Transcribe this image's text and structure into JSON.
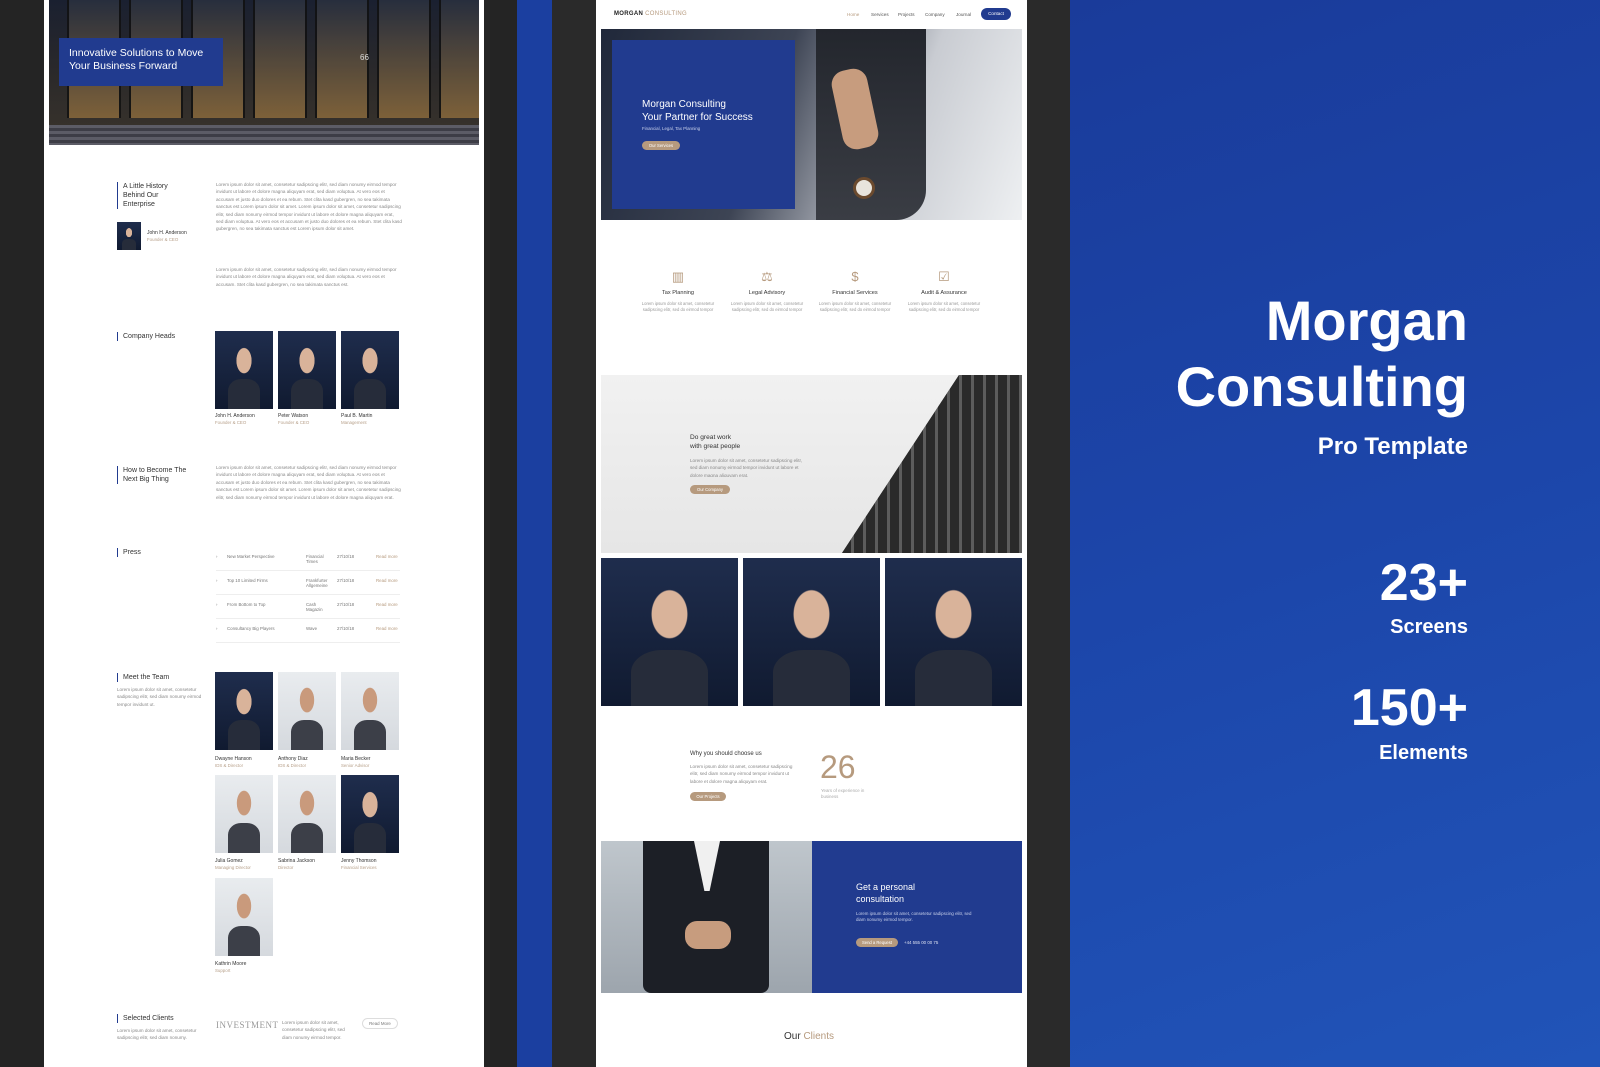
{
  "left_page": {
    "hero_title": "Innovative Solutions to Move Your Business Forward",
    "hero_number": "66",
    "history": {
      "label": "A Little History Behind Our Enterprise",
      "person_name": "John H. Anderson",
      "person_role": "Founder & CEO",
      "paragraph1": "Lorem ipsum dolor sit amet, consetetur sadipscing elitr, sed diam nonumy eirmod tempor invidunt ut labore et dolore magna aliquyam erat, sed diam voluptua. At vero eos et accusam et justo duo dolores et ea rebum. Stet clita kasd gubergren, no sea takimata sanctus est Lorem ipsum dolor sit amet. Lorem ipsum dolor sit amet, consetetur sadipscing elitr, sed diam nonumy eirmod tempor invidunt ut labore et dolore magna aliquyam erat, sed diam voluptua. At vero eos et accusam et justo duo dolores et ea rebum. Stet clita kasd gubergren, no sea takimata sanctus est Lorem ipsum dolor sit amet.",
      "paragraph2": "Lorem ipsum dolor sit amet, consetetur sadipscing elitr, sed diam nonumy eirmod tempor invidunt ut labore et dolore magna aliquyam erat, sed diam voluptua. At vero eos et accusam. Stet clita kasd gubergren, no sea takimata sanctus est."
    },
    "heads": {
      "label": "Company Heads",
      "people": [
        {
          "name": "John H. Anderson",
          "role": "Founder & CEO"
        },
        {
          "name": "Peter Watson",
          "role": "Founder & CEO"
        },
        {
          "name": "Paul B. Martin",
          "role": "Management"
        }
      ]
    },
    "next": {
      "label": "How to Become The Next Big Thing",
      "paragraph": "Lorem ipsum dolor sit amet, consetetur sadipscing elitr, sed diam nonumy eirmod tempor invidunt ut labore et dolore magna aliquyam erat, sed diam voluptua. At vero eos et accusam et justo duo dolores et ea rebum. Stet clita kasd gubergren, no sea takimata sanctus est Lorem ipsum dolor sit amet. Lorem ipsum dolor sit amet, consetetur sadipscing elitr, sed diam nonumy eirmod tempor invidunt ut labore et dolore magna aliquyam erat."
    },
    "press": {
      "label": "Press",
      "read_more": "Read more",
      "rows": [
        {
          "title": "New Market Perspective",
          "source": "Financial Times",
          "date": "27/10/18"
        },
        {
          "title": "Top 10 Limited Firms",
          "source": "Frankfurter Allgemeine",
          "date": "27/10/18"
        },
        {
          "title": "From Bottom to Top",
          "source": "Cash Magazin",
          "date": "27/10/18"
        },
        {
          "title": "Consultancy Big Players",
          "source": "Wave",
          "date": "27/10/18"
        }
      ]
    },
    "team": {
      "label": "Meet the Team",
      "intro": "Lorem ipsum dolor sit amet, consetetur sadipscing elitr, sed diam nonumy eirmod tempor invidunt ut.",
      "members": [
        {
          "name": "Dwayne Hanson",
          "role": "IDS & Director"
        },
        {
          "name": "Anthony Diaz",
          "role": "IDS & Director"
        },
        {
          "name": "Maria Becker",
          "role": "Senior Advisor"
        },
        {
          "name": "Julia Gomez",
          "role": "Managing Director"
        },
        {
          "name": "Sabrina Jackson",
          "role": "Director"
        },
        {
          "name": "Jenny Thomson",
          "role": "Financial Services"
        },
        {
          "name": "Kathrin Moore",
          "role": "Support"
        }
      ]
    },
    "clients": {
      "label": "Selected Clients",
      "intro": "Lorem ipsum dolor sit amet, consetetur sadipscing elitr, sed diam nonumy.",
      "logo": "INVESTMENT",
      "desc": "Lorem ipsum dolor sit amet, consetetur sadipscing elitr, sed diam nonumy eirmod tempor.",
      "button": "Read More"
    }
  },
  "middle_page": {
    "logo_bold": "MORGAN",
    "logo_light": "CONSULTING",
    "nav": [
      "Home",
      "Services",
      "Projects",
      "Company",
      "Journal"
    ],
    "nav_button": "Contact",
    "hero": {
      "title_line1": "Morgan Consulting",
      "title_line2": "Your Partner for Success",
      "subtitle": "Financial, Legal, Tax Planning",
      "button": "Our Services"
    },
    "services": [
      {
        "icon": "chart-icon",
        "title": "Tax Planning",
        "desc": "Lorem ipsum dolor sit amet, consetetur sadipscing elitr, sed do eirmod tempor"
      },
      {
        "icon": "scale-icon",
        "title": "Legal Advisory",
        "desc": "Lorem ipsum dolor sit amet, consetetur sadipscing elitr, sed do eirmod tempor"
      },
      {
        "icon": "dollar-icon",
        "title": "Financial Services",
        "desc": "Lorem ipsum dolor sit amet, consetetur sadipscing elitr, sed do eirmod tempor"
      },
      {
        "icon": "clipboard-icon",
        "title": "Audit & Assurance",
        "desc": "Lorem ipsum dolor sit amet, consetetur sadipscing elitr, sed do eirmod tempor"
      }
    ],
    "work": {
      "title_line1": "Do great work",
      "title_line2": "with great people",
      "desc": "Lorem ipsum dolor sit amet, consetetur sadipscing elitr, sed diam nonumy eirmod tempor invidunt ut labore et dolore magna aliquyam erat.",
      "button": "Our Company"
    },
    "why": {
      "title": "Why you should choose us",
      "desc": "Lorem ipsum dolor sit amet, consetetur sadipscing elitr, sed diam nonumy eirmod tempor invidunt ut labore et dolore magna aliquyam erat.",
      "button": "Our Projects",
      "number": "26",
      "number_caption": "Years of experience in business"
    },
    "consult": {
      "title_line1": "Get a personal",
      "title_line2": "consultation",
      "desc": "Lorem ipsum dolor sit amet, consetetur sadipscing elitr, sed diam nonumy eirmod tempor.",
      "button": "Send a Request",
      "phone": "+44 555 00 00 75"
    },
    "clients_heading_a": "Our",
    "clients_heading_b": "Clients"
  },
  "promo": {
    "title_line1": "Morgan",
    "title_line2": "Consulting",
    "subtitle": "Pro Template",
    "stat1_value": "23+",
    "stat1_label": "Screens",
    "stat2_value": "150+",
    "stat2_label": "Elements"
  },
  "colors": {
    "brand_blue": "#213b8f",
    "accent_gold": "#b69a7e",
    "promo_blue": "#1c46aa"
  }
}
